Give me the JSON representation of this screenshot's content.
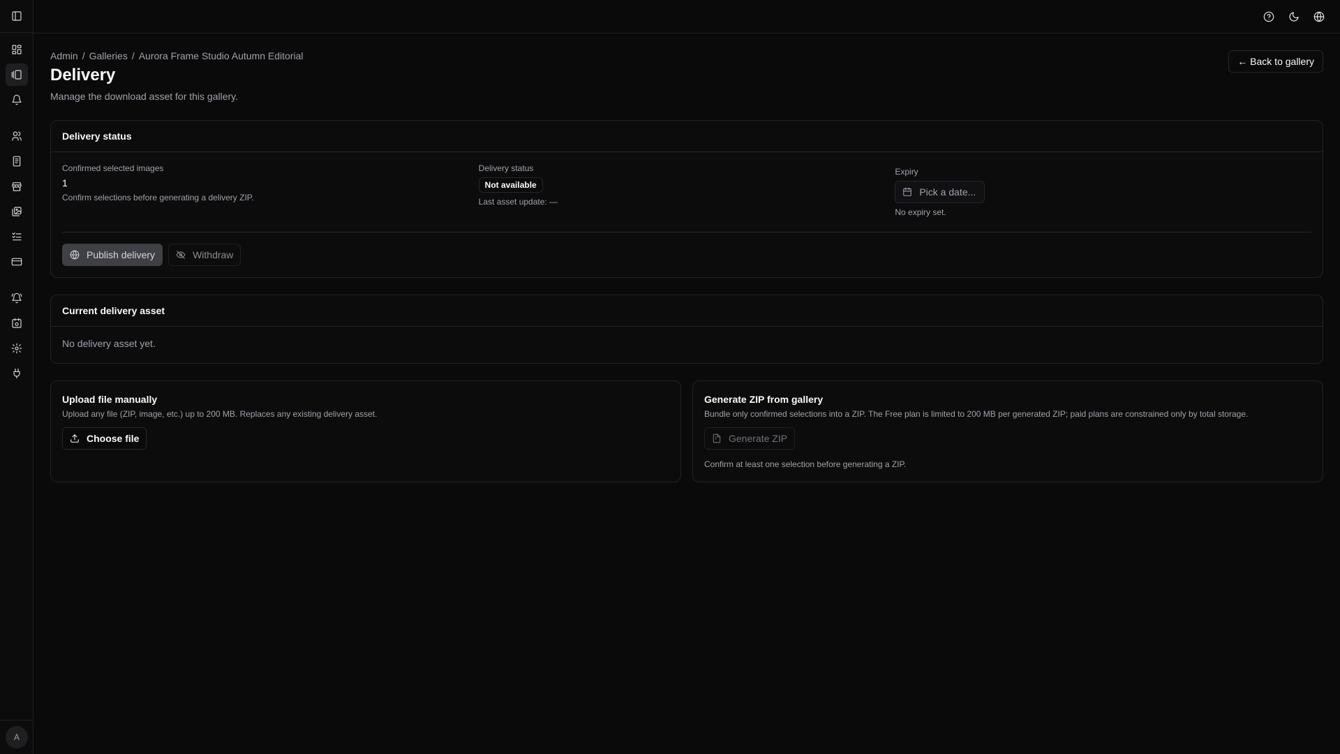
{
  "breadcrumb": [
    "Admin",
    "Galleries",
    "Aurora Frame Studio Autumn Editorial"
  ],
  "breadcrumb_sep": "/",
  "page": {
    "title": "Delivery",
    "subtitle": "Manage the download asset for this gallery.",
    "back_label": "← Back to gallery"
  },
  "status_card": {
    "title": "Delivery status",
    "confirmed_label": "Confirmed selected images",
    "confirmed_value": "1",
    "confirmed_note": "Confirm selections before generating a delivery ZIP.",
    "delivery_label": "Delivery status",
    "delivery_badge": "Not available",
    "last_update": "Last asset update: —",
    "expiry_label": "Expiry",
    "expiry_placeholder": "Pick a date...",
    "expiry_note": "No expiry set.",
    "publish_label": "Publish delivery",
    "withdraw_label": "Withdraw"
  },
  "asset_card": {
    "title": "Current delivery asset",
    "empty": "No delivery asset yet."
  },
  "upload_card": {
    "title": "Upload file manually",
    "subtitle": "Upload any file (ZIP, image, etc.) up to 200 MB. Replaces any existing delivery asset.",
    "button": "Choose file"
  },
  "zip_card": {
    "title": "Generate ZIP from gallery",
    "subtitle": "Bundle only confirmed selections into a ZIP. The Free plan is limited to 200 MB per generated ZIP; paid plans are constrained only by total storage.",
    "button": "Generate ZIP",
    "note": "Confirm at least one selection before generating a ZIP."
  },
  "avatar_initial": "A",
  "sidebar_icons": [
    "panel-toggle-icon",
    "dashboard-icon",
    "galleries-icon",
    "notifications-icon",
    "clients-icon",
    "invoices-icon",
    "store-icon",
    "images-icon",
    "tasks-icon",
    "billing-icon",
    "alerts-icon",
    "calendar-icon",
    "settings-icon",
    "integrations-icon"
  ],
  "topbar_icons": [
    "help-icon",
    "theme-icon",
    "language-icon"
  ]
}
